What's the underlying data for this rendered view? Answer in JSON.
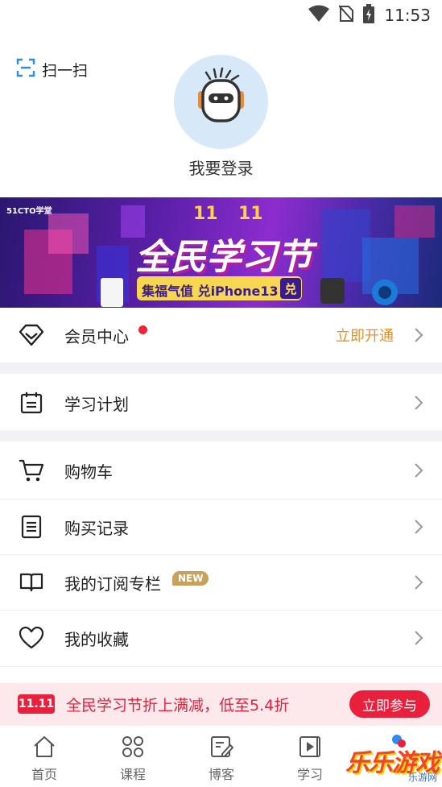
{
  "status_bar": {
    "time": "11:53",
    "icons": [
      "wifi-icon",
      "no-sim-icon",
      "battery-charging-icon"
    ]
  },
  "header": {
    "scan_label": "扫一扫",
    "login_label": "我要登录"
  },
  "banner": {
    "brand": "51CTO学堂",
    "date_left": "11",
    "date_right": "11",
    "headline": "全民学习节",
    "subline": "集福气值 兑iPhone13",
    "badge": "兑"
  },
  "menu": {
    "vip": {
      "label": "会员中心",
      "action": "立即开通",
      "icon": "diamond-icon"
    },
    "plan": {
      "label": "学习计划",
      "icon": "calendar-icon"
    },
    "cart": {
      "label": "购物车",
      "icon": "cart-icon"
    },
    "orders": {
      "label": "购买记录",
      "icon": "receipt-icon"
    },
    "subs": {
      "label": "我的订阅专栏",
      "badge": "NEW",
      "icon": "book-icon"
    },
    "favs": {
      "label": "我的收藏",
      "icon": "heart-icon"
    }
  },
  "promo": {
    "tag": "11.11",
    "text": "全民学习节折上满减，低至5.4折",
    "button": "立即参与"
  },
  "tabs": [
    {
      "label": "首页",
      "icon": "home-icon"
    },
    {
      "label": "课程",
      "icon": "grid-icon"
    },
    {
      "label": "博客",
      "icon": "edit-icon"
    },
    {
      "label": "学习",
      "icon": "play-icon"
    }
  ],
  "watermark": {
    "text": "乐乐游戏",
    "sub": "乐游网"
  },
  "colors": {
    "accent_red": "#e9203b",
    "vip_orange": "#e8902a",
    "badge_gold": "#c8a25a",
    "avatar_bg": "#d7e8f8",
    "icon_blue": "#2d8cf0"
  }
}
